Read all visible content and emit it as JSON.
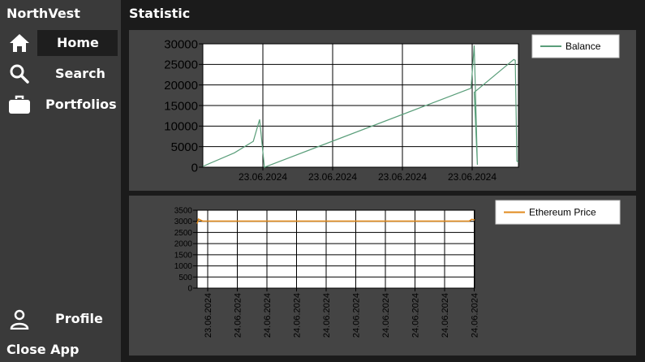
{
  "app": {
    "title": "NorthVest"
  },
  "sidebar": {
    "items": [
      {
        "label": "Home",
        "icon": "home-icon",
        "active": true
      },
      {
        "label": "Search",
        "icon": "search-icon",
        "active": false
      },
      {
        "label": "Portfolios",
        "icon": "briefcase-icon",
        "active": false
      }
    ],
    "profile": {
      "label": "Profile",
      "icon": "user-icon"
    },
    "close_label": "Close App"
  },
  "main": {
    "title": "Statistic"
  },
  "colors": {
    "sidebar_bg": "#3a3a3a",
    "panel_bg": "#444444",
    "balance_line": "#5a9e7a",
    "eth_line": "#e08a1e"
  },
  "chart_data": [
    {
      "type": "line",
      "title": "",
      "xlabel": "",
      "ylabel": "",
      "ylim": [
        0,
        30000
      ],
      "yticks": [
        0,
        5000,
        10000,
        15000,
        20000,
        25000,
        30000
      ],
      "xtick_labels": [
        "23.06.2024",
        "23.06.2024",
        "23.06.2024",
        "23.06.2024"
      ],
      "legend": "top-right",
      "grid": true,
      "series": [
        {
          "name": "Balance",
          "color": "#5a9e7a",
          "x": [
            0,
            0.1,
            0.16,
            0.18,
            0.195,
            0.85,
            0.86,
            0.87,
            0.86,
            0.985,
            0.99,
            0.995,
            1.0
          ],
          "values": [
            200,
            3500,
            6300,
            11600,
            0,
            19200,
            29600,
            600,
            18200,
            26200,
            26000,
            1500,
            1200
          ]
        }
      ]
    },
    {
      "type": "line",
      "title": "",
      "xlabel": "",
      "ylabel": "",
      "ylim": [
        0,
        3500
      ],
      "yticks": [
        0,
        500,
        1000,
        1500,
        2000,
        2500,
        3000,
        3500
      ],
      "xtick_labels": [
        "23.06.2024",
        "24.06.2024",
        "24.06.2024",
        "24.06.2024",
        "24.06.2024",
        "24.06.2024",
        "24.06.2024",
        "24.06.2024",
        "24.06.2024",
        "24.06.2024"
      ],
      "legend": "top-right",
      "grid": true,
      "series": [
        {
          "name": "Ethereum Price",
          "color": "#e08a1e",
          "x": [
            0,
            0.005,
            0.02,
            0.5,
            0.98,
            0.99,
            1.0
          ],
          "values": [
            2900,
            3100,
            3010,
            3010,
            3010,
            3090,
            3060
          ]
        }
      ]
    }
  ]
}
